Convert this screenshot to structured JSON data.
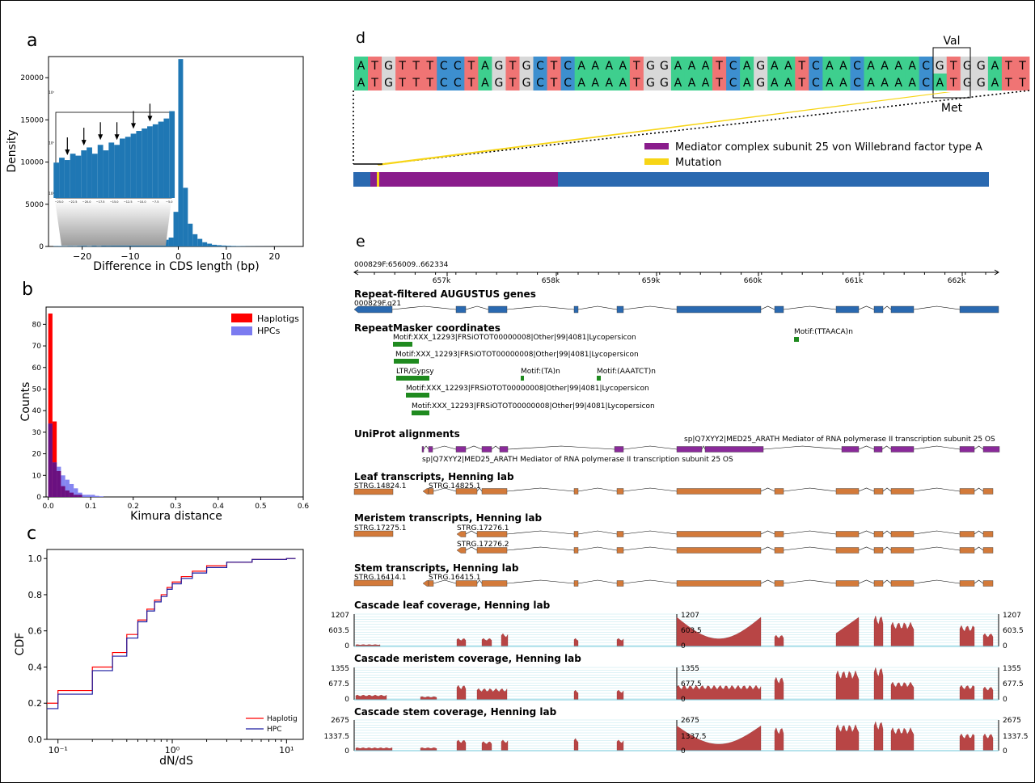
{
  "panel_labels": {
    "a": "a",
    "b": "b",
    "c": "c",
    "d": "d",
    "e": "e"
  },
  "chart_data": [
    {
      "panel": "a",
      "type": "bar",
      "xlabel": "Difference in CDS length (bp)",
      "ylabel": "Density",
      "xlim": [
        -27,
        26
      ],
      "ylim": [
        0,
        22500
      ],
      "xticks": [
        "−20",
        "−10",
        "0",
        "10",
        "20"
      ],
      "yticks": [
        "0",
        "5000",
        "10000",
        "15000",
        "20000"
      ],
      "bin_left": [
        -26,
        -25,
        -24,
        -23,
        -22,
        -21,
        -20,
        -19,
        -18,
        -17,
        -16,
        -15,
        -14,
        -13,
        -12,
        -11,
        -10,
        -9,
        -8,
        -7,
        -6,
        -5,
        -4,
        -3,
        -2,
        -1,
        0,
        1,
        2,
        3,
        4,
        5,
        6,
        7,
        8,
        9,
        10,
        11,
        12,
        13,
        14,
        15,
        16,
        17,
        18,
        19,
        20,
        21,
        22,
        23,
        24
      ],
      "values": [
        40,
        50,
        45,
        60,
        55,
        70,
        80,
        60,
        90,
        70,
        100,
        90,
        120,
        130,
        150,
        170,
        190,
        210,
        230,
        260,
        300,
        420,
        600,
        800,
        1050,
        4100,
        22200,
        6950,
        2700,
        1450,
        900,
        500,
        330,
        200,
        150,
        110,
        80,
        60,
        45,
        35,
        25,
        20,
        15,
        12,
        10,
        8,
        7,
        5,
        4,
        3,
        2
      ],
      "inset": {
        "xticks": [
          "−25.0",
          "−22.5",
          "−20.0",
          "−17.5",
          "−15.0",
          "−12.5",
          "−10.0",
          "−7.5",
          "−5.0"
        ],
        "yticks": [
          "10¹",
          "10²",
          "10³"
        ],
        "arrows_at": [
          -24,
          -21,
          -18,
          -15,
          -12,
          -9
        ]
      }
    },
    {
      "panel": "b",
      "type": "bar",
      "xlabel": "Kimura distance",
      "ylabel": "Counts",
      "xlim": [
        -0.005,
        0.6
      ],
      "ylim": [
        0,
        88
      ],
      "xticks": [
        "0.0",
        "0.1",
        "0.2",
        "0.3",
        "0.4",
        "0.5",
        "0.6"
      ],
      "yticks": [
        "0",
        "10",
        "20",
        "30",
        "40",
        "50",
        "60",
        "70",
        "80"
      ],
      "bin_width": 0.01,
      "series": [
        {
          "name": "Haplotigs",
          "color": "#ff0000",
          "values": [
            85,
            35,
            12,
            5,
            3,
            2,
            1,
            1,
            0,
            0
          ]
        },
        {
          "name": "HPCs",
          "color": "#7b7bf0",
          "values": [
            34,
            16,
            14,
            10,
            8,
            6,
            4,
            2,
            1,
            1,
            1,
            0.5,
            0.3
          ]
        }
      ],
      "legend": [
        "Haplotigs",
        "HPCs"
      ]
    },
    {
      "panel": "c",
      "type": "line",
      "xlabel": "dN/dS",
      "ylabel": "CDF",
      "xscale": "log",
      "xlim": [
        0.08,
        14
      ],
      "ylim": [
        0,
        1.05
      ],
      "xticks": [
        "10⁻¹",
        "10⁰",
        "10¹"
      ],
      "yticks": [
        "0.0",
        "0.2",
        "0.4",
        "0.6",
        "0.8",
        "1.0"
      ],
      "series": [
        {
          "name": "Haplotig",
          "color": "#ff0000",
          "x": [
            0.08,
            0.1,
            0.2,
            0.3,
            0.4,
            0.5,
            0.6,
            0.7,
            0.8,
            0.9,
            1.0,
            1.2,
            1.5,
            2,
            3,
            5,
            10
          ],
          "y": [
            0.2,
            0.27,
            0.4,
            0.48,
            0.58,
            0.66,
            0.72,
            0.77,
            0.8,
            0.84,
            0.87,
            0.9,
            0.93,
            0.96,
            0.98,
            0.995,
            1.0
          ]
        },
        {
          "name": "HPC",
          "color": "#1a1aa0",
          "x": [
            0.08,
            0.1,
            0.2,
            0.3,
            0.4,
            0.5,
            0.6,
            0.7,
            0.8,
            0.9,
            1.0,
            1.2,
            1.5,
            2,
            3,
            5,
            10
          ],
          "y": [
            0.17,
            0.25,
            0.38,
            0.46,
            0.56,
            0.65,
            0.71,
            0.76,
            0.79,
            0.83,
            0.86,
            0.89,
            0.92,
            0.95,
            0.98,
            0.995,
            1.0
          ]
        }
      ],
      "legend": [
        "Haplotig",
        "HPC"
      ]
    }
  ],
  "panel_d": {
    "seq_top": "ATGTTTCCTAGTGCTCAAAATGGAAATCAGAATCAACAAAACGTGGATT",
    "seq_bottom": "ATGTTTCCTAGTGCTCAAAATGGAAATCAGAATCAACAAAACATGGATT",
    "base_colors": {
      "A": "#3ecf8e",
      "T": "#f07474",
      "G": "#d8d8d8",
      "C": "#3d8fcf"
    },
    "codon_top": "Val",
    "codon_bottom": "Met",
    "legend": [
      {
        "label": "Mediator complex subunit 25 von Willebrand factor type A",
        "color": "#8a1c8c"
      },
      {
        "label": "Mutation",
        "color": "#f7d516"
      }
    ],
    "gene_color": "#2a69b0"
  },
  "panel_e": {
    "coord_range": "000829F:656009..662334",
    "ticks": [
      "657k",
      "658k",
      "659k",
      "660k",
      "661k",
      "662k"
    ],
    "tracks": {
      "augustus": {
        "title": "Repeat-filtered AUGUSTUS genes",
        "gene": "000829F.g21"
      },
      "repeatmasker": {
        "title": "RepeatMasker coordinates",
        "labels": [
          "Motif:XXX_12293|FRSiOTOT00000008|Other|99|4081|Lycopersicon",
          "Motif:(TTAACA)n",
          "Motif:XXX_12293|FRSiOTOT00000008|Other|99|4081|Lycopersicon",
          "LTR/Gypsy",
          "Motif:(TA)n",
          "Motif:(AAATCT)n",
          "Motif:XXX_12293|FRSiOTOT00000008|Other|99|4081|Lycopersicon",
          "Motif:XXX_12293|FRSiOTOT00000008|Other|99|4081|Lycopersicon"
        ]
      },
      "uniprot": {
        "title": "UniProt alignments",
        "label1": "sp|Q7XYY2|MED25_ARATH Mediator of RNA polymerase II transcription subunit 25 OS",
        "label2": "sp|Q7XYY2|MED25_ARATH Mediator of RNA polymerase II transcription subunit 25 OS"
      },
      "leaf": {
        "title": "Leaf transcripts, Henning lab",
        "t1": "STRG.14824.1",
        "t2": "STRG.14825.1"
      },
      "meristem": {
        "title": "Meristem transcripts, Henning lab",
        "t1": "STRG.17275.1",
        "t2": "STRG.17276.1",
        "t3": "STRG.17276.2"
      },
      "stem": {
        "title": "Stem transcripts, Henning lab",
        "t1": "STRG.16414.1",
        "t2": "STRG.16415.1"
      },
      "cov_leaf": {
        "title": "Cascade leaf coverage, Henning lab",
        "max": "1207",
        "mid": "603.5",
        "zero": "0"
      },
      "cov_meristem": {
        "title": "Cascade meristem coverage, Henning lab",
        "max": "1355",
        "mid": "677.5",
        "zero": "0"
      },
      "cov_stem": {
        "title": "Cascade stem coverage, Henning lab",
        "max": "2675",
        "mid": "1337.5",
        "zero": "0"
      }
    },
    "colors": {
      "gene": "#2a69b0",
      "repeat": "#1f8a1f",
      "uniprot": "#8a2a9a",
      "transcript": "#d37a3a",
      "coverage": "#b84545"
    }
  }
}
